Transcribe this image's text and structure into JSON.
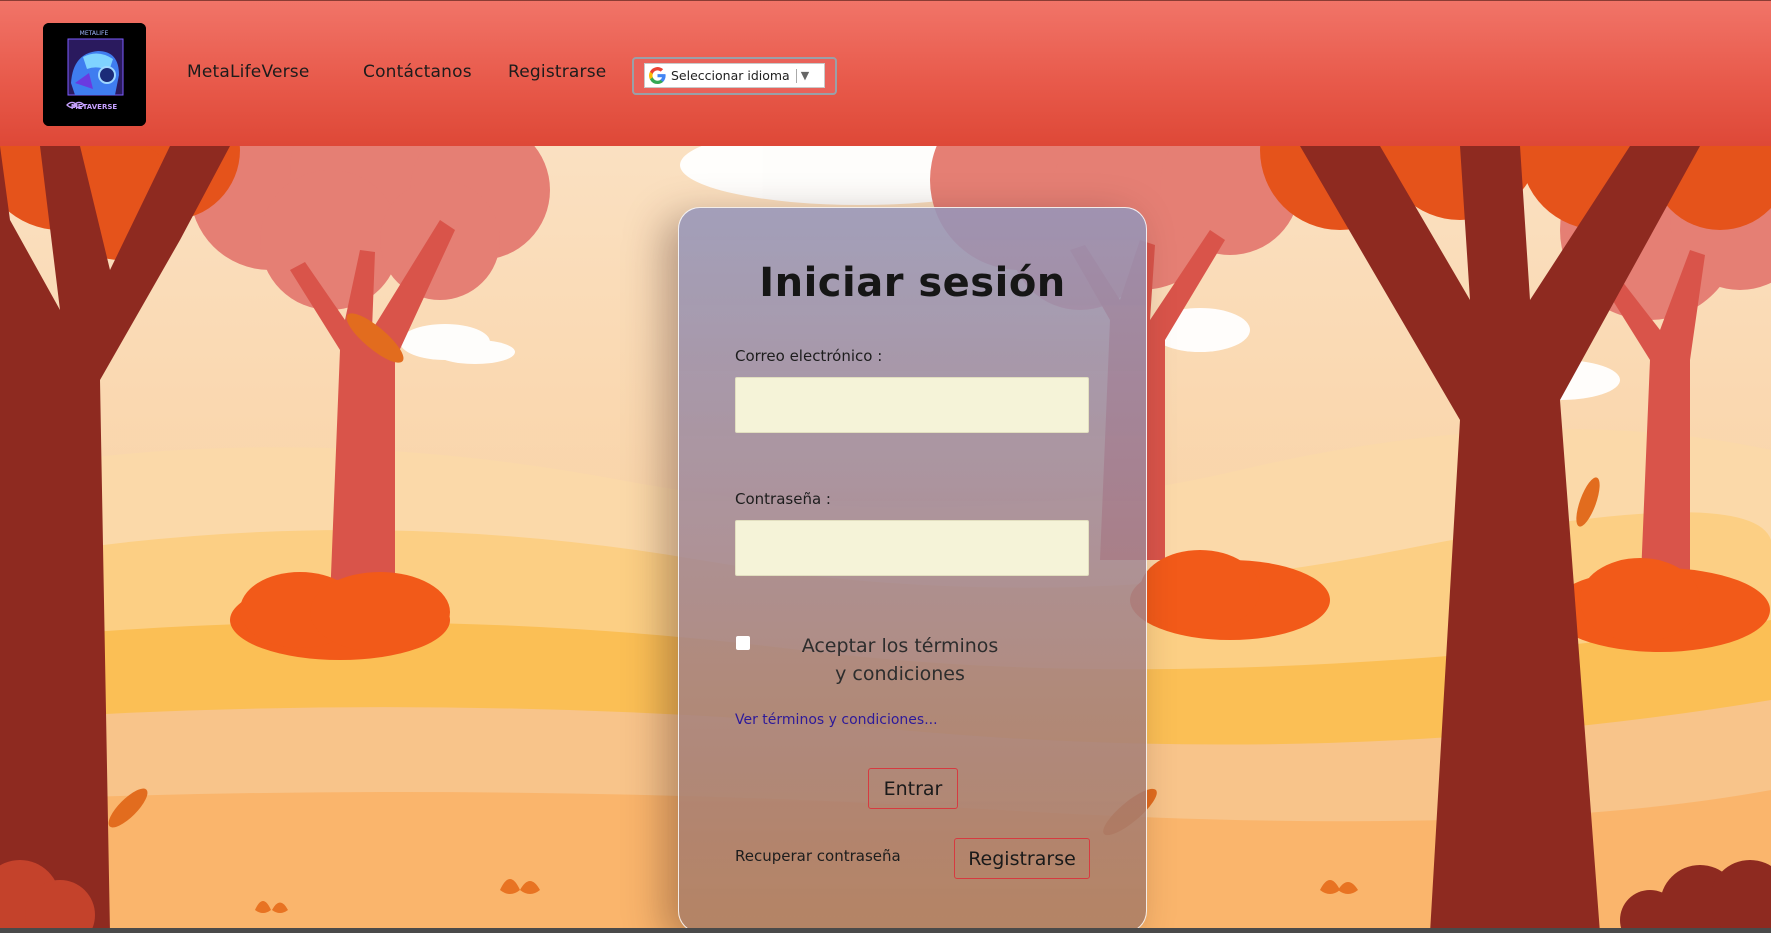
{
  "header": {
    "logo_alt": "MetaLifeVerse logo",
    "logo_text_top": "METALIFE",
    "logo_text_bottom": "METAVERSE",
    "nav": {
      "brand": "MetaLifeVerse",
      "contact": "Contáctanos",
      "register": "Registrarse"
    },
    "language": {
      "label": "Seleccionar idioma",
      "caret": "▼"
    }
  },
  "login": {
    "title": "Iniciar sesión",
    "email_label": "Correo electrónico :",
    "email_value": "",
    "password_label": "Contraseña :",
    "password_value": "",
    "terms_checked": false,
    "terms_text": "Aceptar los términos y condiciones",
    "terms_link": "Ver términos y condiciones...",
    "submit_label": "Entrar",
    "recover_label": "Recuperar contraseña",
    "register_label": "Registrarse"
  },
  "colors": {
    "header": "#e85a4b",
    "field_bg": "#f5f3d8",
    "button_border": "#d63a40",
    "link": "#2d1a9a",
    "tree_trunk": "#8e2a20",
    "tree_light": "#d9544a",
    "foliage_orange": "#e5531b",
    "foliage_pink": "#e57f74"
  }
}
